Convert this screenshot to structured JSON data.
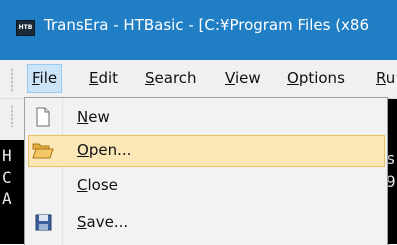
{
  "window": {
    "app_icon_text": "HTB",
    "title": "TransEra - HTBasic - [C:¥Program Files (x86"
  },
  "menubar": {
    "items": [
      {
        "u": "F",
        "rest": "ile"
      },
      {
        "u": "E",
        "rest": "dit"
      },
      {
        "u": "S",
        "rest": "earch"
      },
      {
        "u": "V",
        "rest": "iew"
      },
      {
        "u": "O",
        "rest": "ptions"
      },
      {
        "u": "R",
        "rest": "u"
      }
    ]
  },
  "file_menu": {
    "items": [
      {
        "u": "N",
        "rest": "ew",
        "icon": "new-document-icon"
      },
      {
        "u": "O",
        "rest": "pen...",
        "icon": "open-folder-icon",
        "highlighted": true
      },
      {
        "u": "C",
        "rest": "lose",
        "icon": ""
      },
      {
        "u": "S",
        "rest": "ave...",
        "icon": "save-disk-icon"
      }
    ]
  },
  "console": {
    "left_chars": [
      "H",
      "C",
      "A"
    ],
    "right_chars": [
      "s",
      "9"
    ]
  },
  "colors": {
    "titlebar": "#1f7ec4",
    "menu_active": "#cce4f7",
    "highlight": "#fbe7b5"
  }
}
